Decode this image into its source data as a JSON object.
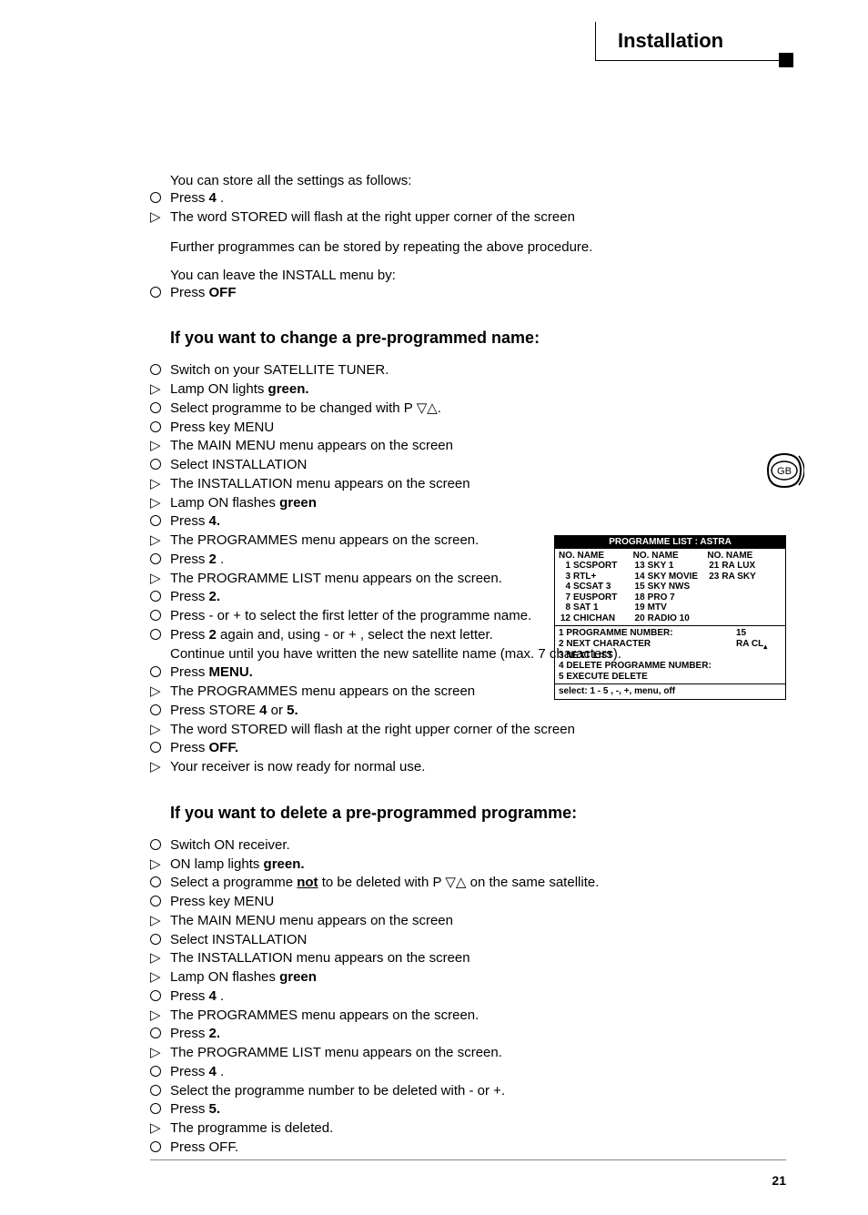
{
  "header": {
    "title": "Installation"
  },
  "gb_label": "GB",
  "page_number": "21",
  "intro": {
    "line1": "You can store all the settings as follows:",
    "press4": "Press",
    "press4_bold": "4",
    "press4_end": " .",
    "stored_line": "The word  STORED will flash at the right upper corner of the screen",
    "further": "Further programmes can be stored by repeating the above procedure.",
    "leave": "You can leave the INSTALL menu by:",
    "press_off": "Press",
    "press_off_bold": "OFF"
  },
  "section1": {
    "title": "If you want to change a pre-programmed name:",
    "items": [
      {
        "g": "c",
        "t": "Switch on your SATELLITE TUNER."
      },
      {
        "g": "t",
        "pre": "Lamp ON lights ",
        "bold": "green.",
        "post": ""
      },
      {
        "g": "c",
        "t": "Select programme to be changed with P ▽△."
      },
      {
        "g": "c",
        "t": "Press key MENU"
      },
      {
        "g": "t",
        "t": "The MAIN MENU menu appears on the screen"
      },
      {
        "g": "c",
        "t": "Select INSTALLATION"
      },
      {
        "g": "t",
        "t": "The INSTALLATION menu appears on the screen"
      },
      {
        "g": "t",
        "pre": "Lamp ON flashes ",
        "bold": "green",
        "post": ""
      },
      {
        "g": "c",
        "pre": "Press ",
        "bold": "4.",
        "post": ""
      },
      {
        "g": "t",
        "t": "The PROGRAMMES menu appears on the screen."
      },
      {
        "g": "c",
        "pre": "Press ",
        "bold": "2",
        "post": " ."
      },
      {
        "g": "t",
        "t": "The PROGRAMME LIST menu appears on the screen."
      },
      {
        "g": "c",
        "pre": "Press ",
        "bold": "2.",
        "post": ""
      },
      {
        "g": "c",
        "t": "Press - or + to select the first letter of the programme name."
      },
      {
        "g": "c",
        "pre": "Press ",
        "bold": "2",
        "post": " again and,  using - or + , select the next letter."
      },
      {
        "g": "",
        "t": "Continue until you have written the new satellite name (max. 7 characters)."
      },
      {
        "g": "c",
        "pre": "Press ",
        "bold": "MENU.",
        "post": ""
      },
      {
        "g": "t",
        "t": "The PROGRAMMES menu appears on the screen"
      },
      {
        "g": "c",
        "pre": "Press STORE ",
        "bold": "4",
        "post": " or ",
        "bold2": "5.",
        "post2": ""
      },
      {
        "g": "t",
        "t": "The word  STORED will flash at the right upper corner of the screen"
      },
      {
        "g": "c",
        "pre": "Press ",
        "bold": "OFF.",
        "post": ""
      },
      {
        "g": "t",
        "t": "Your receiver is now ready for normal use."
      }
    ]
  },
  "section2": {
    "title": "If you want to delete a pre-programmed programme:",
    "items": [
      {
        "g": "c",
        "t": "Switch ON receiver."
      },
      {
        "g": "t",
        "pre": "ON lamp lights ",
        "bold": "green.",
        "post": ""
      },
      {
        "g": "c",
        "pre": "Select a programme  ",
        "under": "not",
        "post": "  to be deleted with P ▽△  on the same satellite."
      },
      {
        "g": "c",
        "t": "Press key MENU"
      },
      {
        "g": "t",
        "t": "The MAIN MENU menu appears on the screen"
      },
      {
        "g": "c",
        "t": "Select INSTALLATION"
      },
      {
        "g": "t",
        "t": "The INSTALLATION menu appears on the screen"
      },
      {
        "g": "t",
        "pre": "Lamp ON flashes ",
        "bold": "green",
        "post": ""
      },
      {
        "g": "c",
        "pre": "Press ",
        "bold": "4",
        "post": " ."
      },
      {
        "g": "t",
        "t": "The PROGRAMMES menu appears on the screen."
      },
      {
        "g": "c",
        "pre": "Press ",
        "bold": "2.",
        "post": ""
      },
      {
        "g": "t",
        "t": "The PROGRAMME LIST menu appears on the screen."
      },
      {
        "g": "c",
        "pre": "Press ",
        "bold": "4",
        "post": " ."
      },
      {
        "g": "c",
        "t": "Select the programme number to be deleted with - or +."
      },
      {
        "g": "c",
        "pre": "Press  ",
        "bold": "5.",
        "post": ""
      },
      {
        "g": "t",
        "t": "The programme is deleted."
      },
      {
        "g": "c",
        "t": "Press OFF."
      }
    ]
  },
  "table": {
    "title": "PROGRAMME LIST : ASTRA",
    "header": "NO. NAME",
    "columns": [
      [
        {
          "no": "1",
          "name": "SCSPORT"
        },
        {
          "no": "3",
          "name": "RTL+"
        },
        {
          "no": "4",
          "name": "SCSAT 3"
        },
        {
          "no": "7",
          "name": "EUSPORT"
        },
        {
          "no": "8",
          "name": "SAT 1"
        },
        {
          "no": "12",
          "name": "CHICHAN"
        }
      ],
      [
        {
          "no": "13",
          "name": "SKY 1"
        },
        {
          "no": "14",
          "name": "SKY MOVIE"
        },
        {
          "no": "15",
          "name": "SKY NWS"
        },
        {
          "no": "18",
          "name": "PRO 7"
        },
        {
          "no": "19",
          "name": "MTV"
        },
        {
          "no": "20",
          "name": "RADIO 10"
        }
      ],
      [
        {
          "no": "21",
          "name": "RA LUX"
        },
        {
          "no": "23",
          "name": "RA SKY"
        }
      ]
    ],
    "mid": [
      {
        "l": "1 PROGRAMME NUMBER:",
        "r": "15"
      },
      {
        "l": "2 NEXT CHARACTER",
        "r": "RA CL"
      },
      {
        "l": "3 NEXT LIST",
        "r": ""
      },
      {
        "l": "4 DELETE PROGRAMME NUMBER:",
        "r": ""
      },
      {
        "l": "5 EXECUTE DELETE",
        "r": ""
      }
    ],
    "bottom": "select: 1 - 5 , -, +, menu, off"
  }
}
